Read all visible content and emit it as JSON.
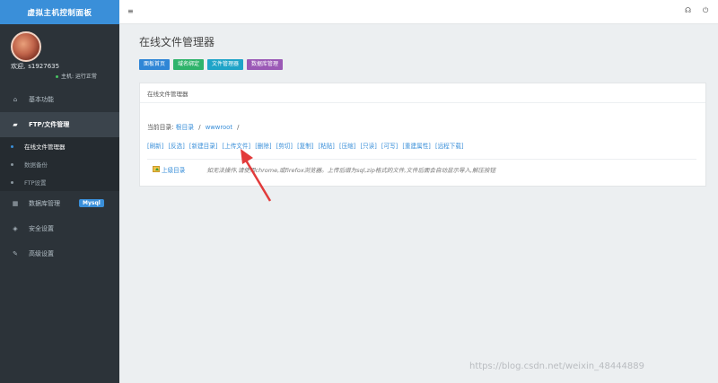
{
  "sidebar": {
    "brand": "虚拟主机控制面板",
    "welcome": "欢迎,",
    "username": "s1927635",
    "host_status": "主机: 运行正常",
    "nav": [
      {
        "label": "基本功能",
        "icon": "home-icon"
      },
      {
        "label": "FTP/文件管理",
        "icon": "folder-open-icon"
      },
      {
        "label": "数据库管理",
        "icon": "database-icon",
        "badge": "Mysql"
      },
      {
        "label": "安全设置",
        "icon": "shield-icon"
      },
      {
        "label": "高级设置",
        "icon": "edit-icon"
      }
    ],
    "sub_items": [
      "在线文件管理器",
      "数据备份",
      "FTP设置"
    ]
  },
  "topbar": {
    "menu_icon": "menu-icon",
    "headset_icon": "headset-icon",
    "power_icon": "power-icon"
  },
  "page": {
    "title": "在线文件管理器"
  },
  "quick_buttons": [
    {
      "label": "面板首页",
      "color": "#2f86d6"
    },
    {
      "label": "域名绑定",
      "color": "#2fb36b"
    },
    {
      "label": "文件管理器",
      "color": "#1fa4c8"
    },
    {
      "label": "数据库管理",
      "color": "#9b59b6"
    }
  ],
  "panel": {
    "heading": "在线文件管理器",
    "crumb_prefix": "当前目录:",
    "crumb_root": "根目录",
    "crumb_dir": "wwwroot",
    "crumb_sep": "/",
    "actions": [
      "[刷新]",
      "[反选]",
      "[新建目录]",
      "[上传文件]",
      "[删除]",
      "[剪切]",
      "[复制]",
      "[粘贴]",
      "[压缩]",
      "[只读]",
      "[可写]",
      "[重建属性]",
      "[远程下载]"
    ],
    "up_label": "上级目录",
    "hint": "如无法操作,请使用chrome,或firefox浏览器。上传后缀为sql,zip格式的文件,文件后面会自动显示导入,解压按钮"
  },
  "watermark": "https://blog.csdn.net/weixin_48444889",
  "colors": {
    "accent": "#3a8fd9",
    "sidebar_bg": "#2c3339",
    "arrow": "#e23b3b"
  }
}
